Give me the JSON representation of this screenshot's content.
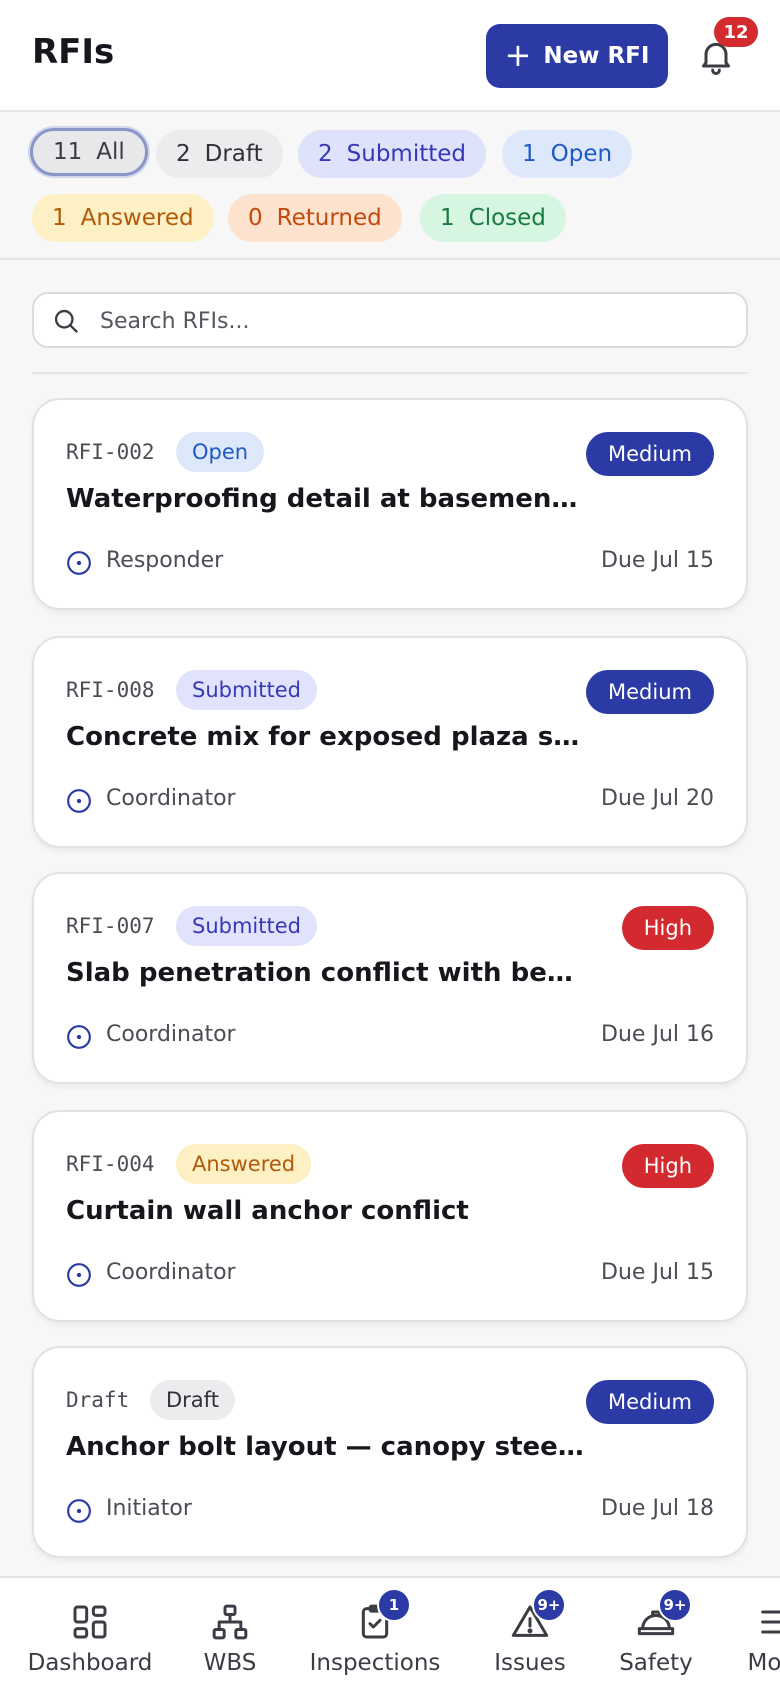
{
  "header": {
    "title": "RFIs",
    "new_button_label": "New RFI",
    "notification_count": "12"
  },
  "filters": [
    {
      "count": "11",
      "label": "All",
      "selected": true
    },
    {
      "count": "2",
      "label": "Draft"
    },
    {
      "count": "2",
      "label": "Submitted"
    },
    {
      "count": "1",
      "label": "Open"
    },
    {
      "count": "1",
      "label": "Answered"
    },
    {
      "count": "0",
      "label": "Returned"
    },
    {
      "count": "1",
      "label": "Closed"
    }
  ],
  "search": {
    "placeholder": "Search RFIs..."
  },
  "cards": [
    {
      "id": "RFI-002",
      "status": "Open",
      "priority": "Medium",
      "title": "Waterproofing detail at basement wall",
      "role": "Responder",
      "due": "Due Jul 15"
    },
    {
      "id": "RFI-008",
      "status": "Submitted",
      "priority": "Medium",
      "title": "Concrete mix for exposed plaza slab",
      "role": "Coordinator",
      "due": "Due Jul 20"
    },
    {
      "id": "RFI-007",
      "status": "Submitted",
      "priority": "High",
      "title": "Slab penetration conflict with beam layout",
      "role": "Coordinator",
      "due": "Due Jul 16"
    },
    {
      "id": "RFI-004",
      "status": "Answered",
      "priority": "High",
      "title": "Curtain wall anchor conflict",
      "role": "Coordinator",
      "due": "Due Jul 15"
    },
    {
      "id": "Draft",
      "status": "Draft",
      "priority": "Medium",
      "title": "Anchor bolt layout — canopy steel columns",
      "role": "Initiator",
      "due": "Due Jul 18"
    }
  ],
  "nav": [
    {
      "label": "Dashboard",
      "icon": "dashboard-icon"
    },
    {
      "label": "WBS",
      "icon": "hierarchy-icon"
    },
    {
      "label": "Inspections",
      "icon": "clipboard-check-icon",
      "badge": "1"
    },
    {
      "label": "Issues",
      "icon": "warning-icon",
      "badge": "9+"
    },
    {
      "label": "Safety",
      "icon": "hardhat-icon",
      "badge": "9+"
    },
    {
      "label": "More",
      "icon": "menu-icon"
    }
  ],
  "colors": {
    "accent": "#2b3aa4",
    "high_priority": "#d32a2f",
    "notification_badge": "#d32a2f"
  }
}
